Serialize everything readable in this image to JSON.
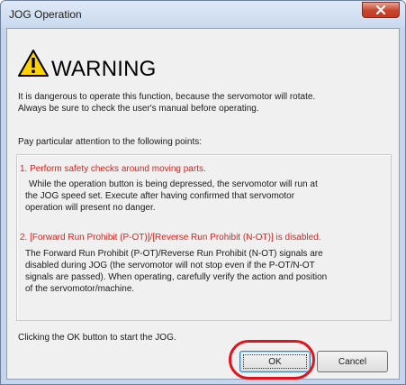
{
  "window": {
    "title": "JOG Operation",
    "close_icon": "close-icon"
  },
  "warning": {
    "heading": "WARNING",
    "icon": "warning-triangle-icon",
    "intro_line1": "It is dangerous to operate this function, because the servomotor will rotate.",
    "intro_line2": "Always be sure to check the user's manual before operating.",
    "attention": "Pay particular attention to the following points:"
  },
  "points": [
    {
      "heading": "1. Perform safety checks around moving parts.",
      "body": [
        "While the operation button is being depressed, the servomotor will run at",
        "the JOG speed set. Execute after having confirmed that servomotor",
        "operation will present no danger."
      ]
    },
    {
      "heading": "2. [Forward Run Prohibit (P-OT)]/[Reverse Run Prohibit (N-OT)] is disabled.",
      "body": [
        "The Forward Run Prohibit (P-OT)/Reverse Run Prohibit (N-OT) signals are",
        "disabled during JOG (the servomotor will not stop even if the P-OT/N-OT",
        "signals are passed). When operating, carefully verify the action and position",
        "of the servomotor/machine."
      ]
    }
  ],
  "prompt": "Clicking the OK button to start the JOG.",
  "buttons": {
    "ok": "OK",
    "cancel": "Cancel"
  },
  "colors": {
    "warning_red": "#e0201a",
    "highlight_red": "#e2141b",
    "close_button": "#c7442c"
  }
}
